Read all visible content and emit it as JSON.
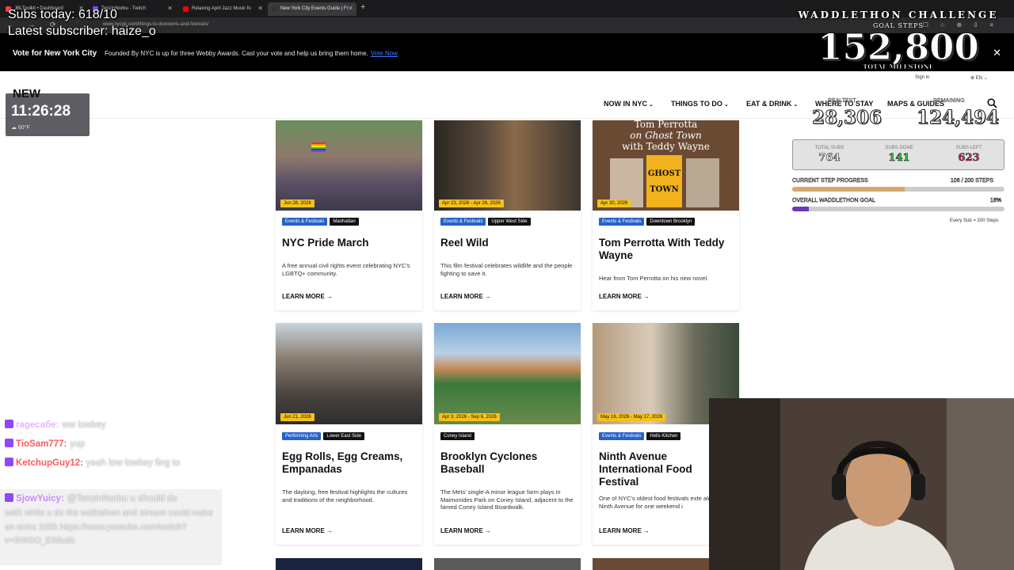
{
  "browser": {
    "tabs": [
      {
        "label": "JBLToolkit • Dashboard",
        "icon_color": "#ff4444"
      },
      {
        "label": "TenzinNorbu - Twitch",
        "icon_color": "#9146ff"
      },
      {
        "label": "Relaxing April Jazz Music fo",
        "icon_color": "#ff0000"
      },
      {
        "label": "New York City Events Guide | Fr",
        "icon_color": "#333333"
      }
    ],
    "new_tab": "+",
    "url": "www.nycgo.com/things-to-do/events-and-festivals/"
  },
  "banner": {
    "title": "Vote for New York City",
    "text": "Founded By NYC is up for three Webby Awards. Cast your vote and help us bring them home.",
    "link": "Vote Now",
    "close": "✕"
  },
  "header": {
    "sign_in": "Sign in",
    "language": "EN",
    "nav": [
      "NOW IN NYC",
      "THINGS TO DO",
      "EAT & DRINK",
      "WHERE TO STAY",
      "MAPS & GUIDES"
    ]
  },
  "cards": [
    {
      "date": "Jun 28, 2026",
      "tags": [
        "Events & Festivals",
        "Manhattan"
      ],
      "title": "NYC Pride March",
      "desc": "A free annual civil rights event celebrating NYC's LGBTQ+ community.",
      "link": "LEARN MORE"
    },
    {
      "date": "Apr 23, 2026 - Apr 26, 2026",
      "tags": [
        "Events & Festivals",
        "Upper West Side"
      ],
      "title": "Reel Wild",
      "desc": "This film festival celebrates wildlife and the people fighting to save it.",
      "link": "LEARN MORE"
    },
    {
      "date": "Apr 30, 2026",
      "tags": [
        "Events & Festivals",
        "Downtown Brooklyn"
      ],
      "title": "Tom Perrotta With Teddy Wayne",
      "desc": "Hear from Tom Perrotta on his new novel.",
      "link": "LEARN MORE",
      "img_text": [
        "Tom Perrotta",
        "on Ghost Town",
        "with Teddy Wayne"
      ],
      "book": "GHOST TOWN"
    },
    {
      "date": "Jun 21, 2026",
      "tags": [
        "Performing Arts",
        "Lower East Side"
      ],
      "title": "Egg Rolls, Egg Creams, Empanadas",
      "desc": "The daylong, free festival highlights the cultures and traditions of the neighborhood.",
      "link": "LEARN MORE"
    },
    {
      "date": "Apr 3, 2026 - Sep 6, 2026",
      "tags": [
        "Coney Island"
      ],
      "title": "Brooklyn Cyclones Baseball",
      "desc": "The Mets' single-A minor league farm plays in Maimonides Park on Coney Island, adjacent to the famed Coney Island Boardwalk.",
      "link": "LEARN MORE"
    },
    {
      "date": "May 16, 2026 - May 17, 2026",
      "tags": [
        "Events & Festivals",
        "Hells Kitchen"
      ],
      "title": "Ninth Avenue International Food Festival",
      "desc": "One of NYC's oldest food festivals exte along Ninth Avenue for one weekend i",
      "link": "LEARN MORE"
    }
  ],
  "overlay": {
    "subs_today": "Subs today: 618/10",
    "latest_subscriber": "Latest subscriber: haize_o",
    "clock": {
      "label": "NEW",
      "time": "11:26:28",
      "weather": "60°F"
    },
    "waddlethon": {
      "title": "WADDLETHON CHALLENGE",
      "goal_label": "GOAL STEPS",
      "goal_value": "152,800",
      "total_milestone": "TOTAL MILESTONE",
      "left_label": "REALTEST",
      "left_value": "28,306",
      "right_label": "REMAINING",
      "right_value": "124,494",
      "subs_box": [
        {
          "label": "TOTAL SUBS",
          "value": "764",
          "color": "#ffffff"
        },
        {
          "label": "SUBS DONE",
          "value": "141",
          "color": "#2ecc40"
        },
        {
          "label": "SUBS LEFT",
          "value": "623",
          "color": "#e0325a"
        }
      ],
      "current_step_label": "CURRENT STEP PROGRESS",
      "current_step_value": "106 / 200 STEPS",
      "current_step_fraction": 0.53,
      "overall_label": "OVERALL WADDLETHON GOAL",
      "overall_value": "18%",
      "overall_fraction": 0.08,
      "every_sub": "Every Sub = 200 Steps"
    },
    "chat": [
      {
        "name": "ragecaбe:",
        "msg": "ww lowkey",
        "color": "#e8b4ff"
      },
      {
        "name": "TioSam777:",
        "msg": "yup",
        "color": "#ff5a5a"
      },
      {
        "name": "KetchupGuy12:",
        "msg": "yeah low lowkey fing to",
        "color": "#ff5a5a"
      },
      {
        "name": "SjowYuicy:",
        "msg": "@TenzinNorbu u should do",
        "color": "#c78cff"
      }
    ],
    "chat_long": "walk while u do the walkathon and stream could make an extra 100k https://www.youtube.com/watch?v=9WGO_EIMudc"
  }
}
